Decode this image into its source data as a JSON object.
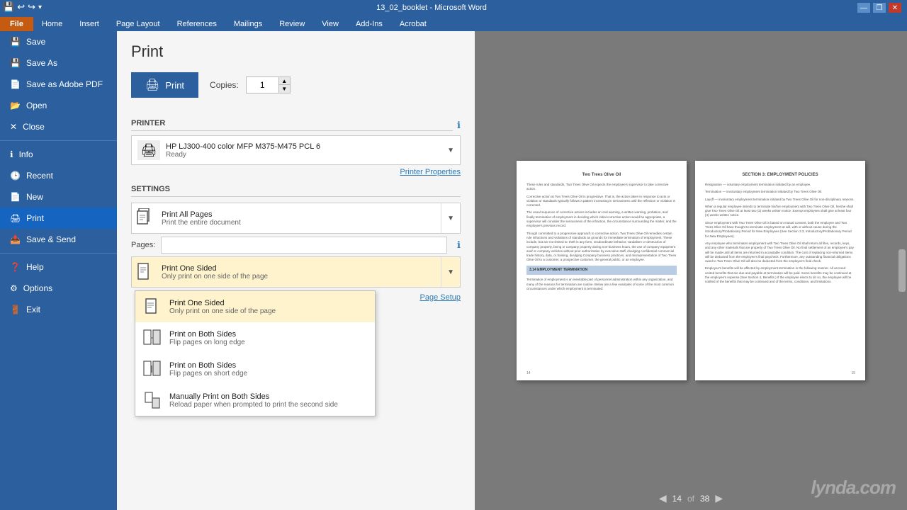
{
  "titlebar": {
    "title": "13_02_booklet - Microsoft Word",
    "controls": [
      "minimize",
      "restore",
      "close"
    ]
  },
  "ribbon": {
    "tabs": [
      "File",
      "Home",
      "Insert",
      "Page Layout",
      "References",
      "Mailings",
      "Review",
      "View",
      "Add-Ins",
      "Acrobat"
    ],
    "active_tab": "File"
  },
  "sidebar": {
    "items": [
      {
        "id": "save",
        "label": "Save"
      },
      {
        "id": "save-as",
        "label": "Save As"
      },
      {
        "id": "save-pdf",
        "label": "Save as Adobe PDF"
      },
      {
        "id": "open",
        "label": "Open"
      },
      {
        "id": "close",
        "label": "Close"
      },
      {
        "id": "info",
        "label": "Info"
      },
      {
        "id": "recent",
        "label": "Recent"
      },
      {
        "id": "new",
        "label": "New"
      },
      {
        "id": "print",
        "label": "Print"
      },
      {
        "id": "save-send",
        "label": "Save & Send"
      },
      {
        "id": "help",
        "label": "Help"
      },
      {
        "id": "options",
        "label": "Options"
      },
      {
        "id": "exit",
        "label": "Exit"
      }
    ],
    "active": "print"
  },
  "print_panel": {
    "title": "Print",
    "copies_label": "Copies:",
    "copies_value": "1",
    "print_button_label": "Print",
    "printer_section_label": "Printer",
    "printer_name": "HP LJ300-400 color MFP M375-M475 PCL 6",
    "printer_status": "Ready",
    "printer_props_link": "Printer Properties",
    "settings_section_label": "Settings",
    "pages_label": "Pages:",
    "pages_placeholder": "",
    "page_setup_link": "Page Setup",
    "settings": [
      {
        "id": "print-all-pages",
        "main": "Print All Pages",
        "sub": "Print the entire document"
      },
      {
        "id": "print-one-sided",
        "main": "Print One Sided",
        "sub": "Only print on one side of the page"
      }
    ]
  },
  "sides_dropdown": {
    "options": [
      {
        "id": "one-sided",
        "main": "Print One Sided",
        "sub": "Only print on one side of the page",
        "selected": true
      },
      {
        "id": "both-long",
        "main": "Print on Both Sides",
        "sub": "Flip pages on long edge",
        "selected": false
      },
      {
        "id": "both-short",
        "main": "Print on Both Sides",
        "sub": "Flip pages on short edge",
        "selected": false
      },
      {
        "id": "manual",
        "main": "Manually Print on Both Sides",
        "sub": "Reload paper when prompted to print the second side",
        "selected": false
      }
    ]
  },
  "preview": {
    "page_current": "14",
    "page_total": "38",
    "left_page": {
      "number": "14",
      "title": "Two Trees Olive Oil",
      "paragraphs": [
        "These rules and standards, Two Trees Olive Oil expects the employee's supervisor to take corrective action.",
        "Corrective action at Two Trees Olive Oil is progressive. That is, the action taken in response to acts or violation or standards typically follows a pattern increasing in seriousness until the reflection or violation is corrected.",
        "The usual sequence of corrective actions includes an oral warning, a written warning, probation, and finally termination of employment in deciding which initial corrective action would be appropriate, a supervisor will consider the seriousness of the infraction, the circumstance surrounding the matter, and the employee's previous record.",
        "Though committed to a progressive approach to corrective action, Two Trees Olive Oil remedies certain rule infractions and violations of standards as grounds for immediate termination of employment. These include, but are not limited to: theft in any form, insubordinate behavior, vandalism or destruction of company property, being or company property during non-business hours, the use of company equipment and/ or company vehicles without prior authorization by executive staff, divulging confidential commercial trade history, data, or training, divulging Company business practices, and misrepresentation of Two Trees Olive Oil to a customer, a prospective customer, the general public, or an employee."
      ],
      "highlight": "3.14 EMPLOYMENT TERMINATION",
      "highlight_text": "Termination of employment is an inevitable part of personnel administration within any organization, and many of the reasons for termination are routine. Below are a few examples of some of the most common circumstances under which employment is terminated:"
    },
    "right_page": {
      "number": "15",
      "title": "SECTION 3: EMPLOYMENT POLICIES",
      "paragraphs": [
        "Resignation — voluntary employment termination initiated by an employee.",
        "Termination — involuntary employment termination initiated by Two Trees Olive Oil.",
        "Layoff — involuntary employment termination initiated by Two Trees Olive Oil for non-disciplinary reasons.",
        "When a regular employee intends to terminate his/her employment with Two Trees Olive Oil, he/she shall give Two Trees Olive Oil at least two (2) weeks written notice. Exempt employees shall give at least four (4) weeks written notice.",
        "Since employment with Two Trees Olive Oil is based on mutual consent, both the employee and Two Trees Olive Oil have thought to terminate employment at will, with or without cause during the introductory/Probationary Period for New Employees (See Section 3.3, Introductory/Probationary Period for New Employees).",
        "Any employee who terminates employment with Two Trees Olive Oil shall return all files, records, keys, and any other materials that are property of Two Trees Olive Oil. No final settlement of an employee's pay will be made until all items are returned in acceptable condition. The cost of replacing non-returned items will be deducted from the employee's final paycheck. Furthermore, any outstanding financial obligations owed to Two Trees Olive Oil will also be deducted from the employee's final check.",
        "Employee's benefits will be affected by employment termination in the following manner. All accrued vested benefits that are due and payable at termination will be paid. Some benefits may be continued at the employee's expense (See Section 4, Benefits.) If the employee elects to do so, the employee will be notified of the benefits that may be continued and of the terms, conditions, and limitations."
      ]
    }
  },
  "watermark": "lynda.com"
}
